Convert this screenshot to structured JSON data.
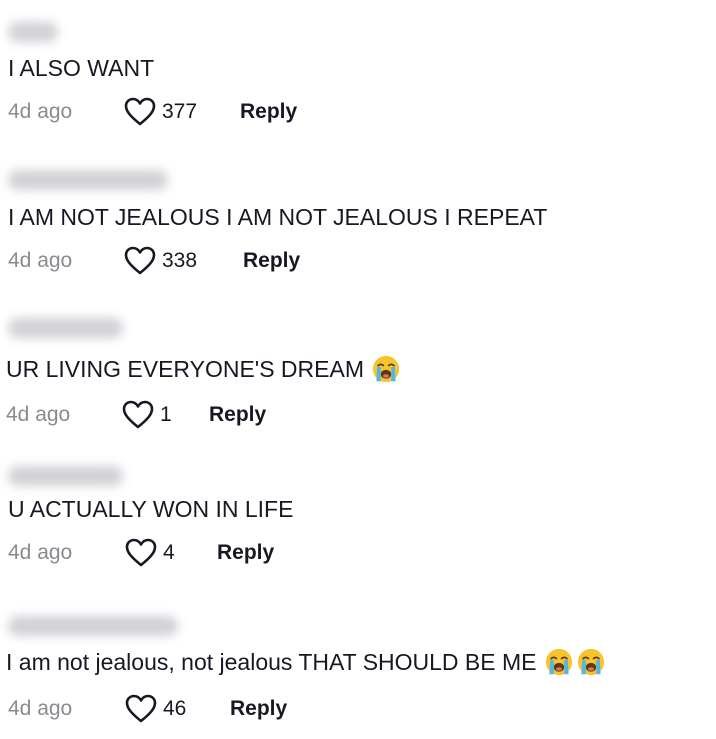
{
  "comments": [
    {
      "text": "I ALSO WANT",
      "time": "4d ago",
      "likes": "377",
      "reply_label": "Reply",
      "emojis": []
    },
    {
      "text": "I AM NOT JEALOUS I AM NOT JEALOUS I REPEAT",
      "time": "4d ago",
      "likes": "338",
      "reply_label": "Reply",
      "emojis": []
    },
    {
      "text": "UR LIVING EVERYONE'S DREAM",
      "time": "4d ago",
      "likes": "1",
      "reply_label": "Reply",
      "emojis": [
        "loudly-crying-face-icon"
      ]
    },
    {
      "text": "U ACTUALLY WON IN LIFE",
      "time": "4d ago",
      "likes": "4",
      "reply_label": "Reply",
      "emojis": []
    },
    {
      "text": "I am not jealous, not jealous THAT SHOULD BE ME",
      "time": "4d ago",
      "likes": "46",
      "reply_label": "Reply",
      "emojis": [
        "loudly-crying-face-icon",
        "loudly-crying-face-icon"
      ]
    }
  ],
  "colors": {
    "text": "#161823",
    "muted": "#8a8b91",
    "username_blur": "#c9c9cf"
  }
}
